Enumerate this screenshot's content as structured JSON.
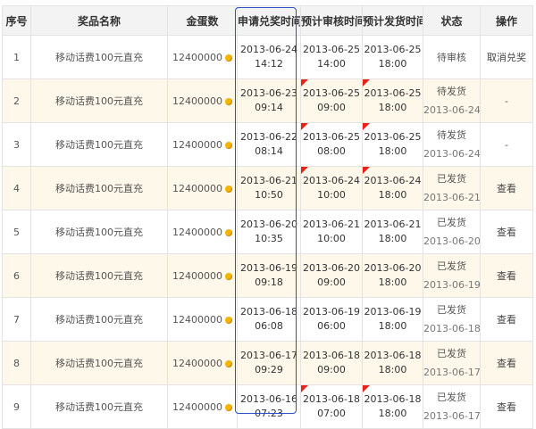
{
  "columns": [
    "序号",
    "奖品名称",
    "金蛋数",
    "申请兑奖时间",
    "预计审核时间",
    "预计发货时间",
    "状态",
    "操作"
  ],
  "rows": [
    {
      "no": "1",
      "prize": "移动话费100元直充",
      "eggs": "12400000",
      "apply": [
        "2013-06-24",
        "14:12"
      ],
      "audit": [
        "2013-06-25",
        "14:00"
      ],
      "ship": [
        "2013-06-25",
        "18:00"
      ],
      "audit_flag": false,
      "ship_flag": false,
      "status": "待审核",
      "status_date": "",
      "op": "取消兑奖"
    },
    {
      "no": "2",
      "prize": "移动话费100元直充",
      "eggs": "12400000",
      "apply": [
        "2013-06-23",
        "09:14"
      ],
      "audit": [
        "2013-06-25",
        "09:00"
      ],
      "ship": [
        "2013-06-25",
        "18:00"
      ],
      "audit_flag": true,
      "ship_flag": true,
      "status": "待发货",
      "status_date": "2013-06-24",
      "op": "-"
    },
    {
      "no": "3",
      "prize": "移动话费100元直充",
      "eggs": "12400000",
      "apply": [
        "2013-06-22",
        "08:14"
      ],
      "audit": [
        "2013-06-25",
        "08:00"
      ],
      "ship": [
        "2013-06-25",
        "18:00"
      ],
      "audit_flag": true,
      "ship_flag": true,
      "status": "待发货",
      "status_date": "2013-06-24",
      "op": "-"
    },
    {
      "no": "4",
      "prize": "移动话费100元直充",
      "eggs": "12400000",
      "apply": [
        "2013-06-21",
        "10:50"
      ],
      "audit": [
        "2013-06-24",
        "10:00"
      ],
      "ship": [
        "2013-06-24",
        "18:00"
      ],
      "audit_flag": true,
      "ship_flag": true,
      "status": "已发货",
      "status_date": "2013-06-21",
      "op": "查看"
    },
    {
      "no": "5",
      "prize": "移动话费100元直充",
      "eggs": "12400000",
      "apply": [
        "2013-06-20",
        "10:35"
      ],
      "audit": [
        "2013-06-21",
        "10:00"
      ],
      "ship": [
        "2013-06-21",
        "18:00"
      ],
      "audit_flag": false,
      "ship_flag": false,
      "status": "已发货",
      "status_date": "2013-06-20",
      "op": "查看"
    },
    {
      "no": "6",
      "prize": "移动话费100元直充",
      "eggs": "12400000",
      "apply": [
        "2013-06-19",
        "09:18"
      ],
      "audit": [
        "2013-06-20",
        "09:00"
      ],
      "ship": [
        "2013-06-20",
        "18:00"
      ],
      "audit_flag": false,
      "ship_flag": false,
      "status": "已发货",
      "status_date": "2013-06-19",
      "op": "查看"
    },
    {
      "no": "7",
      "prize": "移动话费100元直充",
      "eggs": "12400000",
      "apply": [
        "2013-06-18",
        "06:08"
      ],
      "audit": [
        "2013-06-19",
        "06:00"
      ],
      "ship": [
        "2013-06-19",
        "18:00"
      ],
      "audit_flag": false,
      "ship_flag": false,
      "status": "已发货",
      "status_date": "2013-06-18",
      "op": "查看"
    },
    {
      "no": "8",
      "prize": "移动话费100元直充",
      "eggs": "12400000",
      "apply": [
        "2013-06-17",
        "09:29"
      ],
      "audit": [
        "2013-06-18",
        "09:00"
      ],
      "ship": [
        "2013-06-18",
        "18:00"
      ],
      "audit_flag": false,
      "ship_flag": false,
      "status": "已发货",
      "status_date": "2013-06-17",
      "op": "查看"
    },
    {
      "no": "9",
      "prize": "移动话费100元直充",
      "eggs": "12400000",
      "apply": [
        "2013-06-16",
        "07:23"
      ],
      "audit": [
        "2013-06-18",
        "07:00"
      ],
      "ship": [
        "2013-06-18",
        "18:00"
      ],
      "audit_flag": true,
      "ship_flag": true,
      "status": "已发货",
      "status_date": "2013-06-17",
      "op": "查看"
    }
  ],
  "icons": {
    "egg": "gold-coin-icon",
    "flag": "red-corner-flag-icon"
  },
  "colors": {
    "highlight_border": "#2b50c8",
    "flag": "#e9231b",
    "coin": "#f5b400",
    "stripe": "#fdf8ea",
    "header_bg": "#f3f3f3"
  }
}
